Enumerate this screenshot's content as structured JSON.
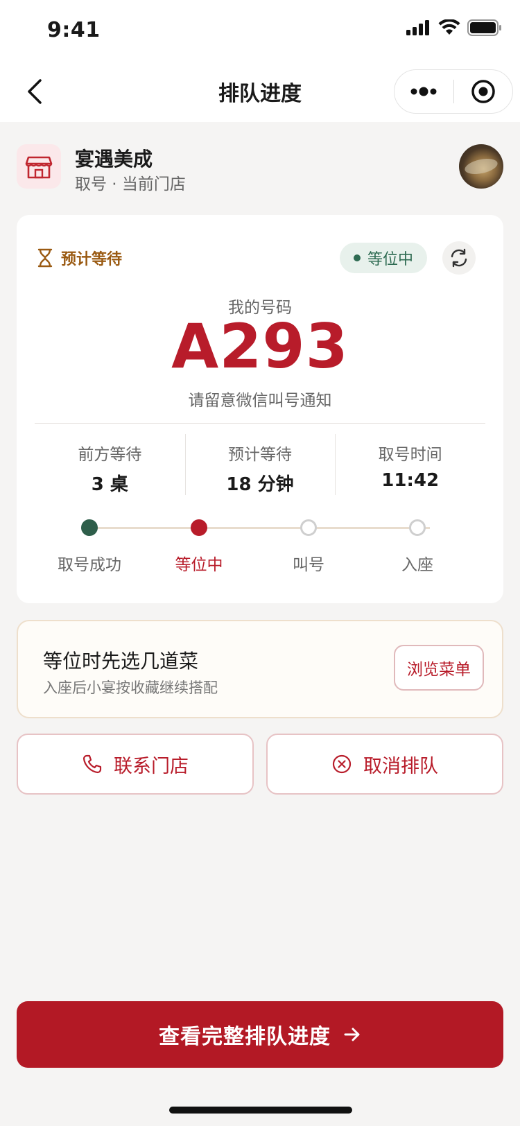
{
  "status_bar": {
    "time": "9:41"
  },
  "nav": {
    "title": "排队进度"
  },
  "store": {
    "name": "宴遇美成",
    "subtitle": "取号 · 当前门店"
  },
  "card": {
    "wait_label": "预计等待",
    "status_pill": "等位中",
    "my_number_label": "我的号码",
    "ticket_number": "A293",
    "notice": "请留意微信叫号通知",
    "stats": [
      {
        "label": "前方等待",
        "value": "3 桌"
      },
      {
        "label": "预计等待",
        "value": "18 分钟"
      },
      {
        "label": "取号时间",
        "value": "11:42"
      }
    ],
    "steps": [
      {
        "label": "取号成功",
        "state": "done"
      },
      {
        "label": "等位中",
        "state": "current"
      },
      {
        "label": "叫号",
        "state": "todo"
      },
      {
        "label": "入座",
        "state": "todo"
      }
    ]
  },
  "menu_suggestion": {
    "title": "等位时先选几道菜",
    "subtitle": "入座后小宴按收藏继续搭配",
    "button": "浏览菜单"
  },
  "actions": {
    "contact": "联系门店",
    "cancel": "取消排队"
  },
  "cta": {
    "label": "查看完整排队进度"
  },
  "colors": {
    "brand": "#b31925",
    "accent_green": "#2e5e4a",
    "wait_orange": "#9a5a12"
  },
  "icons": [
    "signal-icon",
    "wifi-icon",
    "battery-icon",
    "back-icon",
    "more-icon",
    "target-icon",
    "store-icon",
    "hourglass-icon",
    "refresh-icon",
    "phone-icon",
    "cancel-circle-icon",
    "arrow-right-icon"
  ]
}
